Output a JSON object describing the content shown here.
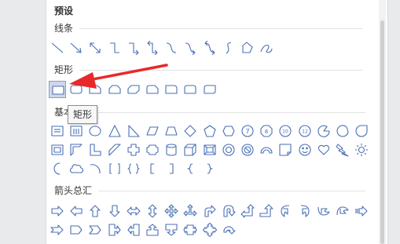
{
  "panel": {
    "preset_title": "预设",
    "sections": [
      {
        "title": "线条",
        "icon_color": "#4a6fb5",
        "rows": [
          [
            "line-icon",
            "arrow-line-icon",
            "double-arrow-line-icon",
            "elbow-connector-icon",
            "elbow-arrow-connector-icon",
            "elbow-double-arrow-connector-icon",
            "curved-connector-icon",
            "curved-arrow-connector-icon",
            "curved-double-arrow-connector-icon",
            "curve-icon",
            "freeform-icon",
            "scribble-icon"
          ]
        ]
      },
      {
        "title": "矩形",
        "icon_color": "#4a6fb5",
        "rows": [
          [
            "rectangle-icon",
            "rounded-rectangle-icon",
            "snip-single-corner-icon",
            "snip-same-side-icon",
            "snip-diagonal-icon",
            "snip-round-icon",
            "round-single-corner-icon",
            "round-same-side-icon",
            "round-diagonal-icon"
          ]
        ]
      },
      {
        "title": "基本形状",
        "icon_color": "#4a6fb5",
        "rows": [
          [
            "text-box-icon",
            "vertical-text-box-icon",
            "oval-icon",
            "triangle-icon",
            "right-triangle-icon",
            "parallelogram-icon",
            "trapezoid-icon",
            "diamond-icon",
            "pentagon-icon",
            "hexagon-icon",
            "heptagon-icon",
            "octagon-icon",
            "decagon-icon",
            "dodecagon-icon",
            "pie-icon",
            "chord-icon",
            "teardrop-icon"
          ],
          [
            "frame-icon",
            "half-frame-icon",
            "l-shape-icon",
            "diagonal-stripe-icon",
            "cross-icon",
            "plaque-icon",
            "can-icon",
            "cube-icon",
            "bevel-icon",
            "donut-icon",
            "no-symbol-icon",
            "block-arc-icon",
            "folded-corner-icon",
            "smiley-face-icon",
            "heart-icon",
            "lightning-bolt-icon",
            "sun-icon"
          ],
          [
            "moon-icon",
            "cloud-icon",
            "arc-icon",
            "double-bracket-icon",
            "double-brace-icon",
            "left-bracket-icon",
            "right-bracket-icon",
            "left-brace-icon",
            "right-brace-icon"
          ]
        ]
      },
      {
        "title": "箭头总汇",
        "icon_color": "#4a6fb5",
        "rows": [
          [
            "right-arrow-icon",
            "left-arrow-icon",
            "up-arrow-icon",
            "down-arrow-icon",
            "left-right-arrow-icon",
            "up-down-arrow-icon",
            "quad-arrow-icon",
            "left-right-up-arrow-icon",
            "bent-arrow-icon",
            "u-turn-arrow-icon",
            "left-up-arrow-icon",
            "bent-up-arrow-icon",
            "curved-right-arrow-icon",
            "curved-left-arrow-icon",
            "curved-up-arrow-icon",
            "curved-down-arrow-icon",
            "striped-right-arrow-icon"
          ],
          [
            "notched-right-arrow-icon",
            "pentagon-arrow-icon",
            "chevron-icon",
            "right-arrow-callout-icon",
            "left-arrow-callout-icon",
            "up-arrow-callout-icon",
            "down-arrow-callout-icon",
            "left-right-arrow-callout-icon",
            "quad-arrow-callout-icon",
            "circular-arrow-icon"
          ]
        ]
      }
    ],
    "selected_shape": "rectangle-icon",
    "tooltip": "矩形",
    "annotation_arrow_color": "#e8292b"
  }
}
